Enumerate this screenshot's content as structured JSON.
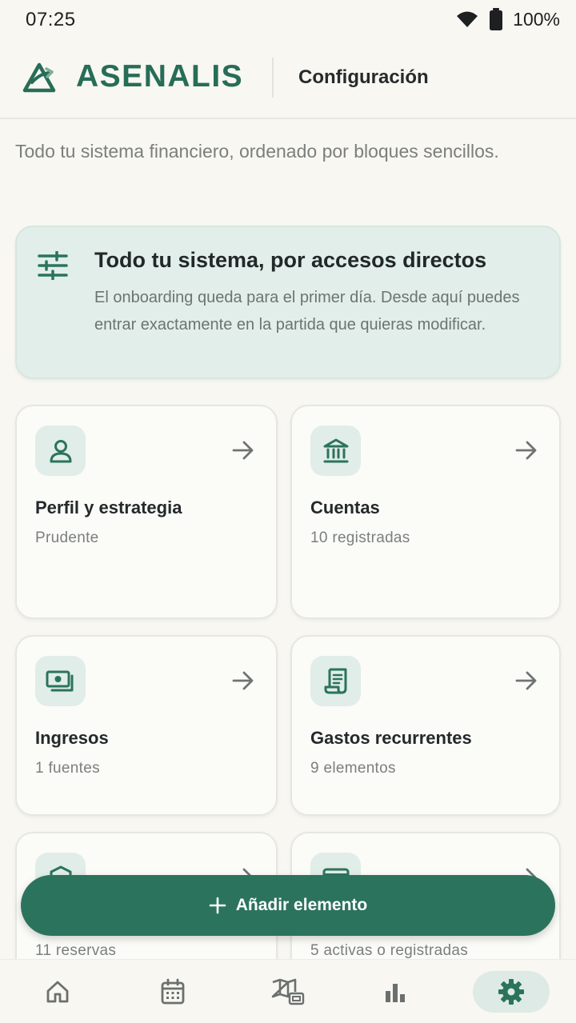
{
  "status": {
    "time": "07:25",
    "battery": "100%"
  },
  "header": {
    "brand": "ASENALIS",
    "title": "Configuración"
  },
  "subtitle": "Todo tu sistema financiero, ordenado por bloques sencillos.",
  "banner": {
    "title": "Todo tu sistema, por accesos directos",
    "text": "El onboarding queda para el primer día. Desde aquí puedes entrar exactamente en la partida que quieras modificar."
  },
  "cards": [
    {
      "title": "Perfil y estrategia",
      "subtitle": "Prudente",
      "icon": "person-icon"
    },
    {
      "title": "Cuentas",
      "subtitle": "10 registradas",
      "icon": "bank-icon"
    },
    {
      "title": "Ingresos",
      "subtitle": "1 fuentes",
      "icon": "money-icon"
    },
    {
      "title": "Gastos recurrentes",
      "subtitle": "9 elementos",
      "icon": "receipt-icon"
    },
    {
      "title": "",
      "subtitle": "11 reservas",
      "icon": "shield-icon"
    },
    {
      "title": "",
      "subtitle": "5 activas o registradas",
      "icon": "credit-card-icon"
    }
  ],
  "fab": {
    "label": "Añadir elemento"
  },
  "nav": {
    "items": [
      "home-icon",
      "calendar-icon",
      "map-icon",
      "bar-chart-icon",
      "gear-icon"
    ],
    "active": "gear-icon"
  },
  "colors": {
    "accent": "#2b735d",
    "brand": "#276d57",
    "banner_bg": "#e2eeea",
    "background": "#f8f7f2"
  }
}
